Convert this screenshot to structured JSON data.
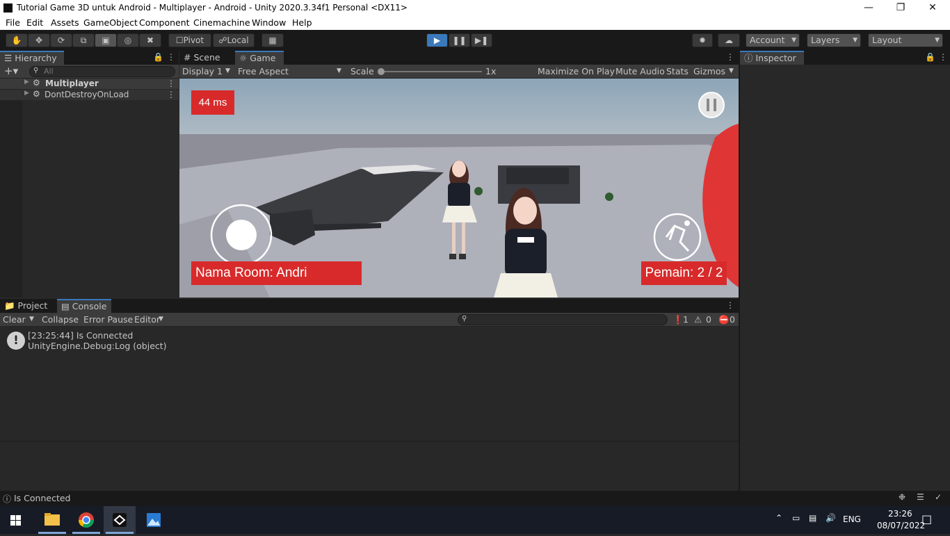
{
  "window": {
    "title": "Tutorial Game 3D untuk Android - Multiplayer - Android - Unity 2020.3.34f1 Personal <DX11>",
    "controls": [
      "minimize",
      "maximize",
      "close"
    ]
  },
  "menu": [
    "File",
    "Edit",
    "Assets",
    "GameObject",
    "Component",
    "Cinemachine",
    "Window",
    "Help"
  ],
  "toolbar": {
    "tools": [
      "hand-icon",
      "move-icon",
      "rotate-icon",
      "scale-icon",
      "rect-icon",
      "transform-icon",
      "custom-tool-icon"
    ],
    "pivot": "Pivot",
    "local": "Local",
    "account": "Account",
    "layers": "Layers",
    "layout": "Layout",
    "play_active": true
  },
  "hierarchy": {
    "tab": "Hierarchy",
    "search_placeholder": "All",
    "items": [
      {
        "label": "Multiplayer"
      },
      {
        "label": "DontDestroyOnLoad"
      }
    ]
  },
  "game_view": {
    "tabs": [
      "Scene",
      "Game"
    ],
    "display": "Display 1",
    "aspect": "Free Aspect",
    "scale_label": "Scale",
    "scale_value": "1x",
    "maximize": "Maximize On Play",
    "mute": "Mute Audio",
    "stats": "Stats",
    "gizmos": "Gizmos",
    "hud": {
      "ping": "44 ms",
      "room": "Nama Room: Andri",
      "players": "Pemain: 2 / 2"
    }
  },
  "inspector": {
    "tab": "Inspector"
  },
  "console": {
    "tabs": [
      "Project",
      "Console"
    ],
    "buttons": {
      "clear": "Clear",
      "collapse": "Collapse",
      "error_pause": "Error Pause",
      "editor": "Editor"
    },
    "counts": {
      "log": "1",
      "warn": "0",
      "error": "0"
    },
    "entries": [
      {
        "line1": "[23:25:44] Is Connected",
        "line2": "UnityEngine.Debug:Log (object)"
      }
    ]
  },
  "status": "Is Connected",
  "taskbar": {
    "lang": "ENG",
    "time": "23:26",
    "date": "08/07/2022"
  },
  "colors": {
    "accent": "#3a79bb",
    "hud_red": "#d82a2a"
  }
}
